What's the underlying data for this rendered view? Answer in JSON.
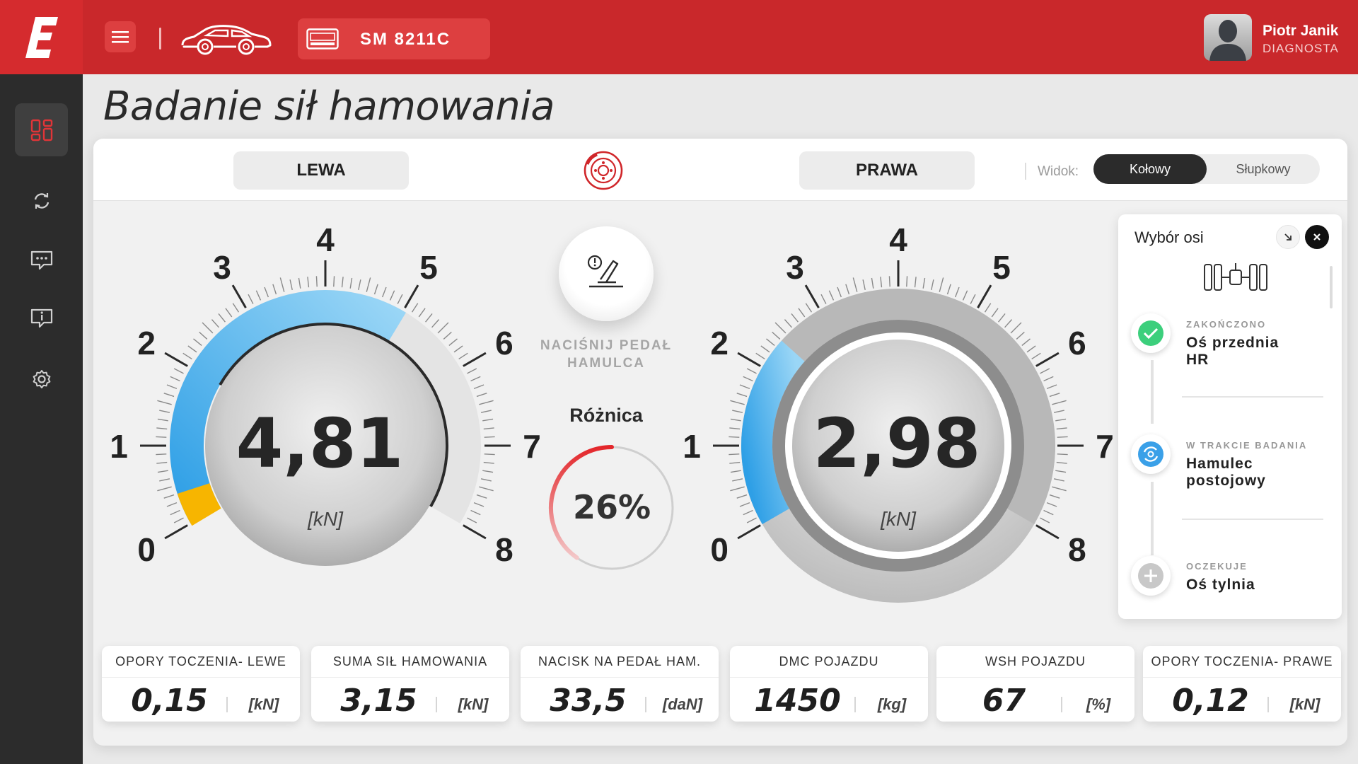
{
  "header": {
    "logo": "E",
    "plate": "SM 8211C",
    "user_name": "Piotr Janik",
    "user_role": "DIAGNOSTA"
  },
  "page": {
    "title": "Badanie sił hamowania"
  },
  "tabs": {
    "left": "LEWA",
    "right": "PRAWA"
  },
  "view": {
    "label": "Widok:",
    "options": [
      "Kołowy",
      "Słupkowy"
    ],
    "selected": "Kołowy"
  },
  "left_gauge": {
    "value": "4,81",
    "unit": "[kN]",
    "reading": 4.81,
    "scale_labels": [
      "0",
      "1",
      "2",
      "3",
      "4",
      "5",
      "6",
      "7",
      "8"
    ],
    "bar_fraction": 0.63
  },
  "right_gauge": {
    "value": "2,98",
    "unit": "[kN]",
    "reading": 2.98,
    "scale_labels": [
      "0",
      "1",
      "2",
      "3",
      "4",
      "5",
      "6",
      "7",
      "8"
    ],
    "bar_fraction": 0.3
  },
  "center": {
    "pedal_text_1": "NACIŚNIJ PEDAŁ",
    "pedal_text_2": "HAMULCA",
    "diff_label": "Różnica",
    "diff_value": "26%",
    "diff_percent": 26
  },
  "axis_panel": {
    "title": "Wybór osi",
    "items": [
      {
        "status": "ZAKOŃCZONO",
        "name_1": "Oś przednia",
        "name_2": "HR",
        "state": "done"
      },
      {
        "status": "W TRAKCIE BADANIA",
        "name_1": "Hamulec",
        "name_2": "postojowy",
        "state": "active"
      },
      {
        "status": "OCZEKUJE",
        "name_1": "Oś tylnia",
        "name_2": "",
        "state": "pending"
      }
    ]
  },
  "stats": [
    {
      "title": "OPORY TOCZENIA- LEWE",
      "value": "0,15",
      "unit": "[kN]"
    },
    {
      "title": "SUMA SIŁ HAMOWANIA",
      "value": "3,15",
      "unit": "[kN]"
    },
    {
      "title": "NACISK NA PEDAŁ HAM.",
      "value": "33,5",
      "unit": "[daN]"
    },
    {
      "title": "DMC POJAZDU",
      "value": "1450",
      "unit": "[kg]"
    },
    {
      "title": "WSH POJAZDU",
      "value": "67",
      "unit": "[%]"
    },
    {
      "title": "OPORY TOCZENIA- PRAWE",
      "value": "0,12",
      "unit": "[kN]"
    }
  ],
  "colors": {
    "brand": "#c9282b",
    "gauge_blue": "#3aa8e8",
    "gauge_yellow": "#f7b500",
    "ok_green": "#3ccf7c",
    "active_blue": "#3aa0e8"
  }
}
